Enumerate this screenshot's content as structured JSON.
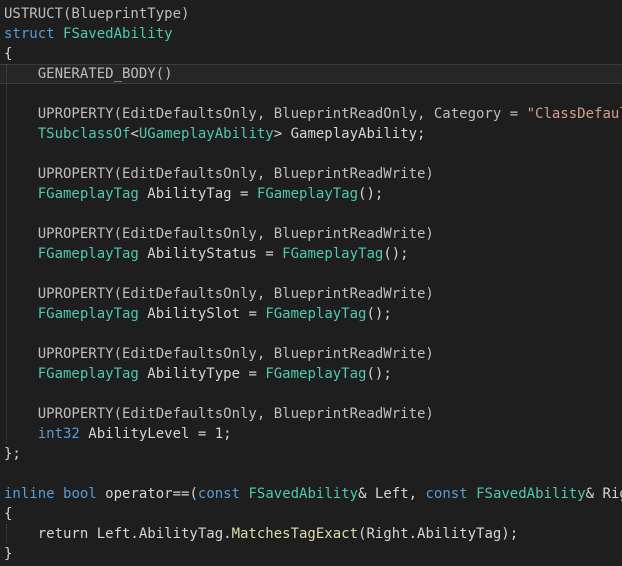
{
  "editor": {
    "lines": [
      [
        {
          "t": "USTRUCT(BlueprintType)",
          "c": "macro"
        }
      ],
      [
        {
          "t": "struct ",
          "c": "keyword"
        },
        {
          "t": "FSavedAbility",
          "c": "type"
        }
      ],
      [
        {
          "t": "{",
          "c": "punct"
        }
      ],
      [
        {
          "t": "    GENERATED_BODY()",
          "c": "macro"
        }
      ],
      [],
      [
        {
          "t": "    UPROPERTY(EditDefaultsOnly, BlueprintReadOnly, Category = ",
          "c": "macro"
        },
        {
          "t": "\"ClassDefaults\"",
          "c": "str"
        },
        {
          "t": ")",
          "c": "punct"
        }
      ],
      [
        {
          "t": "    ",
          "c": "plain"
        },
        {
          "t": "TSubclassOf",
          "c": "type"
        },
        {
          "t": "<",
          "c": "punct"
        },
        {
          "t": "UGameplayAbility",
          "c": "type"
        },
        {
          "t": "> GameplayAbility;",
          "c": "plain"
        }
      ],
      [],
      [
        {
          "t": "    UPROPERTY(EditDefaultsOnly, BlueprintReadWrite)",
          "c": "macro"
        }
      ],
      [
        {
          "t": "    ",
          "c": "plain"
        },
        {
          "t": "FGameplayTag",
          "c": "type"
        },
        {
          "t": " AbilityTag = ",
          "c": "plain"
        },
        {
          "t": "FGameplayTag",
          "c": "type"
        },
        {
          "t": "();",
          "c": "punct"
        }
      ],
      [],
      [
        {
          "t": "    UPROPERTY(EditDefaultsOnly, BlueprintReadWrite)",
          "c": "macro"
        }
      ],
      [
        {
          "t": "    ",
          "c": "plain"
        },
        {
          "t": "FGameplayTag",
          "c": "type"
        },
        {
          "t": " AbilityStatus = ",
          "c": "plain"
        },
        {
          "t": "FGameplayTag",
          "c": "type"
        },
        {
          "t": "();",
          "c": "punct"
        }
      ],
      [],
      [
        {
          "t": "    UPROPERTY(EditDefaultsOnly, BlueprintReadWrite)",
          "c": "macro"
        }
      ],
      [
        {
          "t": "    ",
          "c": "plain"
        },
        {
          "t": "FGameplayTag",
          "c": "type"
        },
        {
          "t": " AbilitySlot = ",
          "c": "plain"
        },
        {
          "t": "FGameplayTag",
          "c": "type"
        },
        {
          "t": "();",
          "c": "punct"
        }
      ],
      [],
      [
        {
          "t": "    UPROPERTY(EditDefaultsOnly, BlueprintReadWrite)",
          "c": "macro"
        }
      ],
      [
        {
          "t": "    ",
          "c": "plain"
        },
        {
          "t": "FGameplayTag",
          "c": "type"
        },
        {
          "t": " AbilityType = ",
          "c": "plain"
        },
        {
          "t": "FGameplayTag",
          "c": "type"
        },
        {
          "t": "();",
          "c": "punct"
        }
      ],
      [],
      [
        {
          "t": "    UPROPERTY(EditDefaultsOnly, BlueprintReadWrite)",
          "c": "macro"
        }
      ],
      [
        {
          "t": "    ",
          "c": "plain"
        },
        {
          "t": "int32",
          "c": "keyword"
        },
        {
          "t": " AbilityLevel = 1;",
          "c": "plain"
        }
      ],
      [
        {
          "t": "};",
          "c": "punct"
        }
      ],
      [],
      [
        {
          "t": "inline",
          "c": "keyword"
        },
        {
          "t": " ",
          "c": "plain"
        },
        {
          "t": "bool",
          "c": "keyword"
        },
        {
          "t": " operator==(",
          "c": "plain"
        },
        {
          "t": "const",
          "c": "keyword"
        },
        {
          "t": " ",
          "c": "plain"
        },
        {
          "t": "FSavedAbility",
          "c": "type"
        },
        {
          "t": "& Left, ",
          "c": "plain"
        },
        {
          "t": "const",
          "c": "keyword"
        },
        {
          "t": " ",
          "c": "plain"
        },
        {
          "t": "FSavedAbility",
          "c": "type"
        },
        {
          "t": "& Right)",
          "c": "plain"
        }
      ],
      [
        {
          "t": "{",
          "c": "punct"
        }
      ],
      [
        {
          "t": "    return Left.AbilityTag.",
          "c": "plain"
        },
        {
          "t": "MatchesTagExact",
          "c": "call"
        },
        {
          "t": "(Right.AbilityTag);",
          "c": "plain"
        }
      ],
      [
        {
          "t": "}",
          "c": "punct"
        }
      ]
    ]
  }
}
